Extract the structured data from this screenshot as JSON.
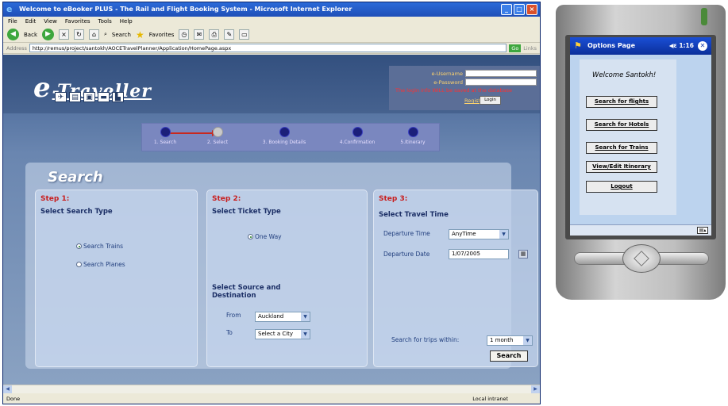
{
  "ie": {
    "title": "Welcome to eBooker PLUS - The Rail and Flight Booking System - Microsoft Internet Explorer",
    "menu": [
      "File",
      "Edit",
      "View",
      "Favorites",
      "Tools",
      "Help"
    ],
    "toolbar": {
      "back_label": "Back",
      "search_label": "Search",
      "favorites_label": "Favorites"
    },
    "address_label": "Address",
    "address_value": "http://remus/project/santokh/AOCETravelPlanner/Application/HomePage.aspx",
    "go_label": "Go",
    "links_label": "Links",
    "status_text": "Done",
    "zone_text": "Local intranet"
  },
  "site": {
    "logo_e": "e",
    "logo_text": "-Traveller",
    "login": {
      "username_label": "e-Username",
      "password_label": "e-Password",
      "note": "The login info WILL be saved at the database",
      "register_label": "Register",
      "login_label": "Login"
    },
    "steps": [
      "1. Search",
      "2. Select",
      "3. Booking Details",
      "4.Confirmation",
      "5.Itinerary"
    ],
    "search_title": "Search",
    "step1": {
      "heading": "Step 1:",
      "subheading": "Select Search Type",
      "option_trains": "Search Trains",
      "option_planes": "Search Planes"
    },
    "step2": {
      "heading": "Step 2:",
      "subheading": "Select Ticket Type",
      "option_oneway": "One Way",
      "source_heading_1": "Select Source and",
      "source_heading_2": "Destination",
      "from_label": "From",
      "from_value": "Auckland",
      "to_label": "To",
      "to_value": "Select a City"
    },
    "step3": {
      "heading": "Step 3:",
      "subheading": "Select Travel Time",
      "dep_time_label": "Departure Time",
      "dep_time_value": "AnyTime",
      "dep_date_label": "Departure Date",
      "dep_date_value": "1/07/2005",
      "within_label": "Search for trips within:",
      "within_value": "1 month",
      "search_button": "Search"
    }
  },
  "ppc": {
    "title": "Options Page",
    "clock": "1:16",
    "welcome": "Welcome Santokh!",
    "buttons": [
      "Search for flights",
      "Search for Hotels",
      "Search for Trains",
      "View/Edit Itinerary",
      "Logout"
    ]
  }
}
